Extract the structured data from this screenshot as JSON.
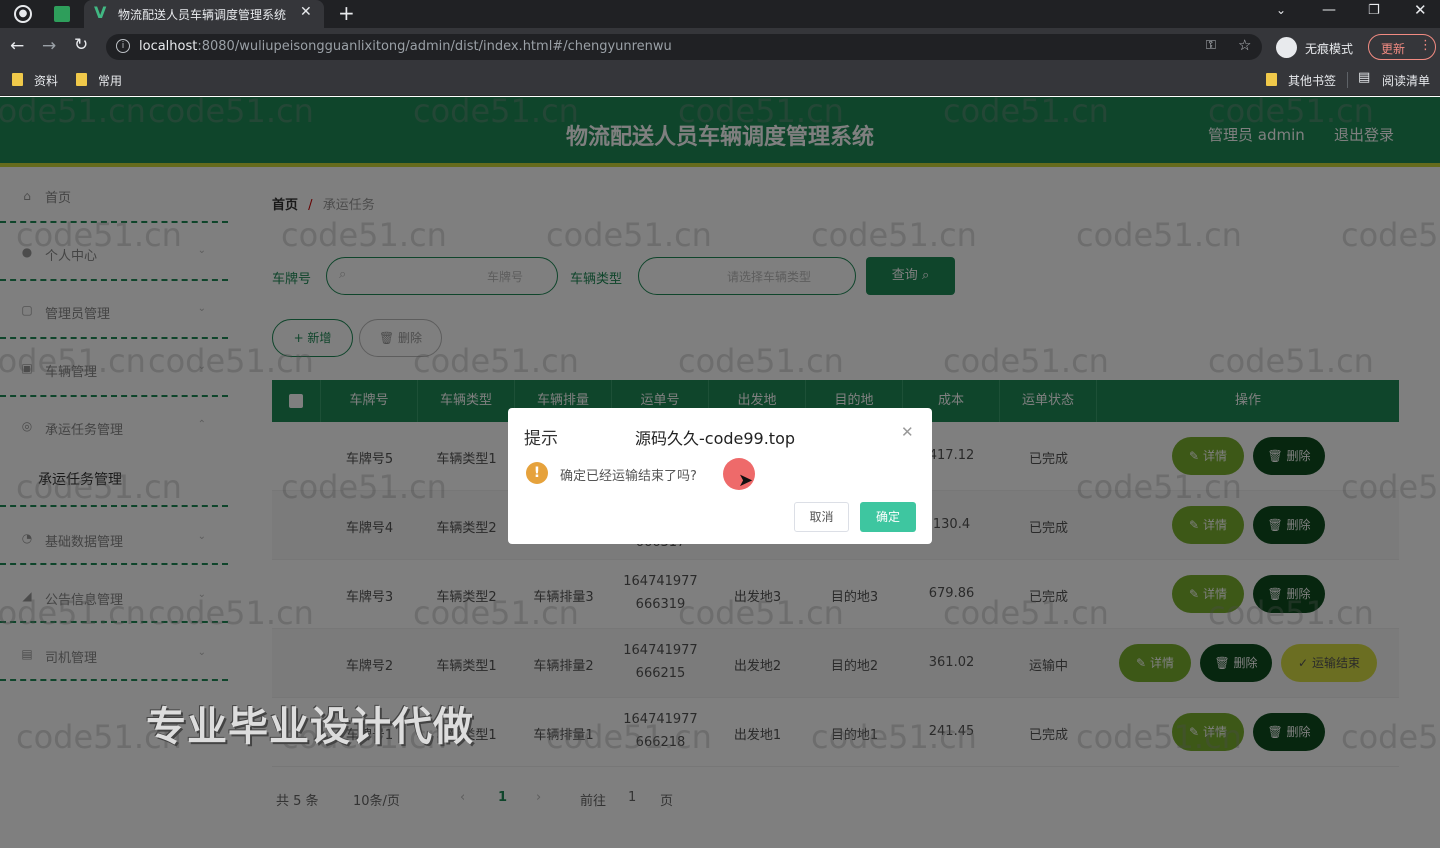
{
  "browser": {
    "tab_title": "物流配送人员车辆调度管理系统",
    "url_host": "localhost",
    "url_rest": ":8080/wuliupeisongguanlixitong/admin/dist/index.html#/chengyunrenwu",
    "incognito_label": "无痕模式",
    "update_label": "更新",
    "bookmarks": [
      "资料",
      "常用"
    ],
    "other_bookmarks": "其他书签",
    "reading_list": "阅读清单"
  },
  "header": {
    "title": "物流配送人员车辆调度管理系统",
    "user": "管理员 admin",
    "logout": "退出登录"
  },
  "sidebar": {
    "items": [
      {
        "label": "首页",
        "icon": "home-icon"
      },
      {
        "label": "个人中心",
        "icon": "user-icon"
      },
      {
        "label": "管理员管理",
        "icon": "admin-icon"
      },
      {
        "label": "车辆管理",
        "icon": "car-icon"
      },
      {
        "label": "承运任务管理",
        "icon": "task-icon"
      },
      {
        "label": "承运任务管理",
        "icon": ""
      },
      {
        "label": "基础数据管理",
        "icon": "data-icon"
      },
      {
        "label": "公告信息管理",
        "icon": "notice-icon"
      },
      {
        "label": "司机管理",
        "icon": "driver-icon"
      }
    ]
  },
  "breadcrumb": {
    "home": "首页",
    "sep": "/",
    "current": "承运任务"
  },
  "search": {
    "plate_label": "车牌号",
    "plate_placeholder": "车牌号",
    "type_label": "车辆类型",
    "type_placeholder": "请选择车辆类型",
    "query_button": "查询"
  },
  "actions": {
    "add": "+ 新增",
    "delete": "删除"
  },
  "table": {
    "headers": [
      "车牌号",
      "车辆类型",
      "车辆排量",
      "运单号",
      "出发地",
      "目的地",
      "成本",
      "运单状态",
      "操作"
    ],
    "rows": [
      {
        "plate": "车牌号5",
        "type": "车辆类型1",
        "displacement": "",
        "order1": "",
        "order2": "",
        "from": "",
        "to": "",
        "cost": "417.12",
        "status": "已完成"
      },
      {
        "plate": "车牌号4",
        "type": "车辆类型2",
        "displacement": "",
        "order1": "",
        "order2": "666317",
        "from": "",
        "to": "",
        "cost": "130.4",
        "status": "已完成"
      },
      {
        "plate": "车牌号3",
        "type": "车辆类型2",
        "displacement": "车辆排量3",
        "order1": "164741977",
        "order2": "666319",
        "from": "出发地3",
        "to": "目的地3",
        "cost": "679.86",
        "status": "已完成"
      },
      {
        "plate": "车牌号2",
        "type": "车辆类型1",
        "displacement": "车辆排量2",
        "order1": "164741977",
        "order2": "666215",
        "from": "出发地2",
        "to": "目的地2",
        "cost": "361.02",
        "status": "运输中"
      },
      {
        "plate": "车牌号1",
        "type": "车辆类型1",
        "displacement": "车辆排量1",
        "order1": "164741977",
        "order2": "666218",
        "from": "出发地1",
        "to": "目的地1",
        "cost": "241.45",
        "status": "已完成"
      }
    ],
    "btn_detail": "详情",
    "btn_delete": "删除",
    "btn_finish": "运输结束"
  },
  "pagination": {
    "total": "共 5 条",
    "size": "10条/页",
    "page": "1",
    "goto": "前往",
    "goto_page": "1",
    "page_suffix": "页"
  },
  "dialog": {
    "title": "提示",
    "brand": "源码久久-code99.top",
    "message": "确定已经运输结束了吗?",
    "cancel": "取消",
    "confirm": "确定"
  },
  "overlay_text": "专业毕业设计代做",
  "watermark": "code51.cn",
  "colors": {
    "primary": "#1f8a57",
    "accent": "#cdd63b",
    "dark": "#0e4d1e",
    "light": "#7ab02e",
    "confirm": "#3ec6a0"
  }
}
